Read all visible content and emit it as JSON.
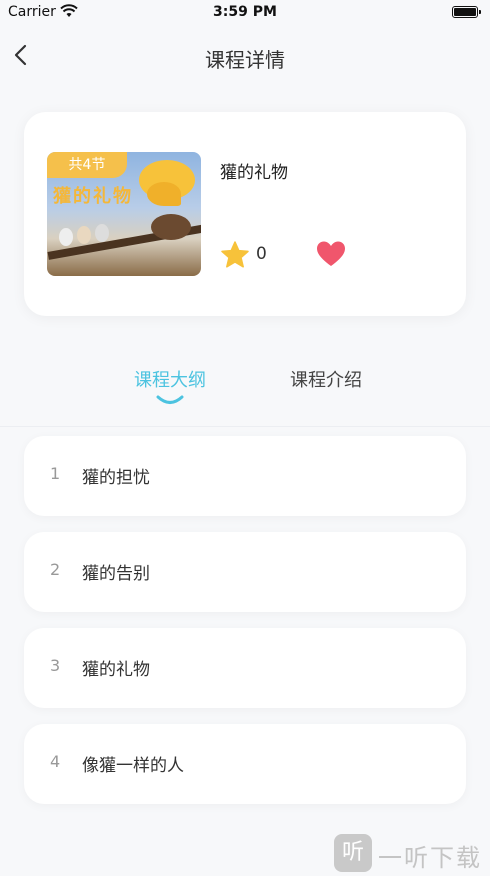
{
  "status": {
    "carrier": "Carrier",
    "time": "3:59 PM"
  },
  "nav": {
    "title": "课程详情"
  },
  "course": {
    "cover_badge": "共4节",
    "cover_title": "獾的礼物",
    "title": "獾的礼物",
    "star_count": "0",
    "colors": {
      "star": "#f7c23a",
      "heart": "#f0566c",
      "badge": "#f5c04b"
    }
  },
  "tabs": [
    {
      "label": "课程大纲",
      "active": true
    },
    {
      "label": "课程介绍",
      "active": false
    }
  ],
  "accent_color": "#4cc3e0",
  "lessons": [
    {
      "num": "1",
      "name": "獾的担忧"
    },
    {
      "num": "2",
      "name": "獾的告别"
    },
    {
      "num": "3",
      "name": "獾的礼物"
    },
    {
      "num": "4",
      "name": "像獾一样的人"
    }
  ],
  "watermark": {
    "logo_text": "听",
    "text": "一听下载"
  }
}
